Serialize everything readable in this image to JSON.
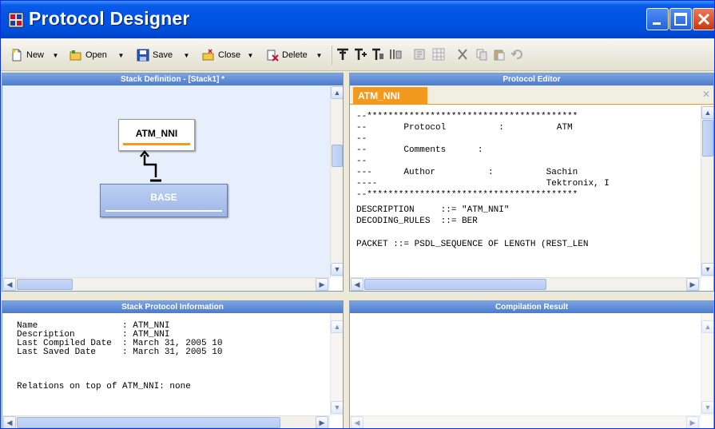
{
  "window": {
    "title": "Protocol Designer"
  },
  "toolbar": {
    "new_label": "New",
    "open_label": "Open",
    "save_label": "Save",
    "close_label": "Close",
    "delete_label": "Delete"
  },
  "stack_definition": {
    "header": "Stack Definition - [Stack1] *",
    "nodes": [
      {
        "label": "ATM_NNI"
      },
      {
        "label": "BASE"
      }
    ]
  },
  "protocol_editor": {
    "header": "Protocol Editor",
    "tab_label": "ATM_NNI",
    "lines": [
      "--****************************************",
      "--       Protocol          :          ATM",
      "--",
      "--       Comments      :",
      "--",
      "---      Author          :          Sachin",
      "----                                Tektronix, I",
      "--****************************************",
      "DESCRIPTION     ::= \"ATM_NNI\"",
      "DECODING_RULES  ::= BER",
      "",
      "PACKET ::= PSDL_SEQUENCE OF LENGTH (REST_LEN"
    ]
  },
  "stack_protocol_info": {
    "header": "Stack Protocol Information",
    "lines": [
      "Name                : ATM_NNI",
      "Description         : ATM_NNI",
      "Last Compiled Date  : March 31, 2005 10",
      "Last Saved Date     : March 31, 2005 10",
      "",
      "Relations on top of ATM_NNI: none"
    ]
  },
  "compilation_result": {
    "header": "Compilation Result"
  },
  "colors": {
    "title_bar": "#0054E3",
    "pane_header": "#5D87D0",
    "tab_orange": "#F39A1E",
    "node_base_fill": "#A9C0EC",
    "node_underline": "#F39A1E"
  }
}
